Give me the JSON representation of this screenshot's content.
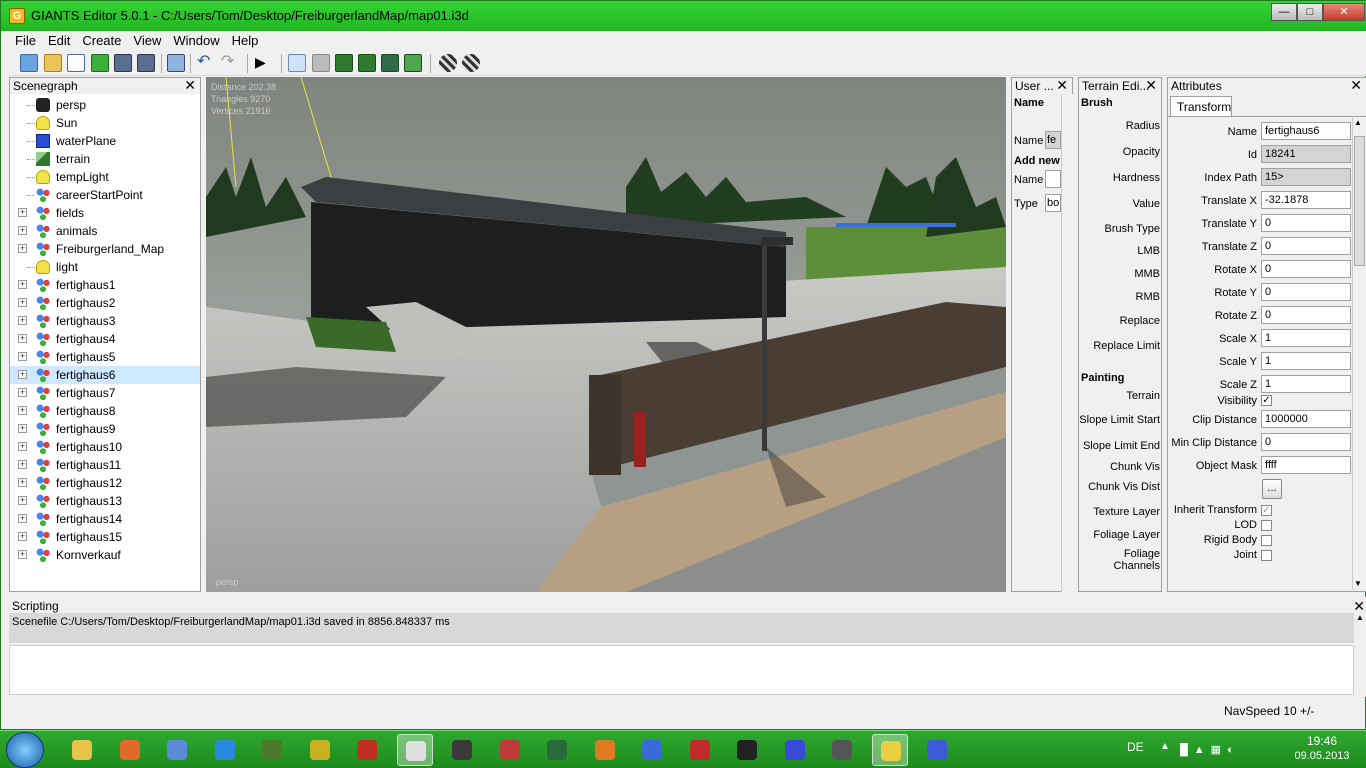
{
  "window": {
    "title": "GIANTS Editor 5.0.1 - C:/Users/Tom/Desktop/FreiburgerlandMap/map01.i3d",
    "app_icon": "G"
  },
  "menu": [
    "File",
    "Edit",
    "Create",
    "View",
    "Window",
    "Help"
  ],
  "scenegraph": {
    "title": "Scenegraph",
    "nodes": [
      {
        "label": "persp",
        "icon": "camera-icon",
        "expandable": false
      },
      {
        "label": "Sun",
        "icon": "light-bulb-icon",
        "expandable": false
      },
      {
        "label": "waterPlane",
        "icon": "cube-icon",
        "expandable": false
      },
      {
        "label": "terrain",
        "icon": "terrain-icon",
        "expandable": false
      },
      {
        "label": "tempLight",
        "icon": "light-bulb-icon",
        "expandable": false
      },
      {
        "label": "careerStartPoint",
        "icon": "transform-group-icon",
        "expandable": false
      },
      {
        "label": "fields",
        "icon": "transform-group-icon",
        "expandable": true
      },
      {
        "label": "animals",
        "icon": "transform-group-icon",
        "expandable": true
      },
      {
        "label": "Freiburgerland_Map",
        "icon": "transform-group-icon",
        "expandable": true
      },
      {
        "label": "light",
        "icon": "light-bulb-icon",
        "expandable": false
      },
      {
        "label": "fertighaus1",
        "icon": "transform-group-icon",
        "expandable": true
      },
      {
        "label": "fertighaus2",
        "icon": "transform-group-icon",
        "expandable": true
      },
      {
        "label": "fertighaus3",
        "icon": "transform-group-icon",
        "expandable": true
      },
      {
        "label": "fertighaus4",
        "icon": "transform-group-icon",
        "expandable": true
      },
      {
        "label": "fertighaus5",
        "icon": "transform-group-icon",
        "expandable": true
      },
      {
        "label": "fertighaus6",
        "icon": "transform-group-icon",
        "expandable": true,
        "selected": true
      },
      {
        "label": "fertighaus7",
        "icon": "transform-group-icon",
        "expandable": true
      },
      {
        "label": "fertighaus8",
        "icon": "transform-group-icon",
        "expandable": true
      },
      {
        "label": "fertighaus9",
        "icon": "transform-group-icon",
        "expandable": true
      },
      {
        "label": "fertighaus10",
        "icon": "transform-group-icon",
        "expandable": true
      },
      {
        "label": "fertighaus11",
        "icon": "transform-group-icon",
        "expandable": true
      },
      {
        "label": "fertighaus12",
        "icon": "transform-group-icon",
        "expandable": true
      },
      {
        "label": "fertighaus13",
        "icon": "transform-group-icon",
        "expandable": true
      },
      {
        "label": "fertighaus14",
        "icon": "transform-group-icon",
        "expandable": true
      },
      {
        "label": "fertighaus15",
        "icon": "transform-group-icon",
        "expandable": true
      },
      {
        "label": "Kornverkauf",
        "icon": "transform-group-icon",
        "expandable": true
      }
    ]
  },
  "viewport": {
    "info": [
      "Distance 202.38",
      "Triangles 9270",
      "Vertices 21916"
    ],
    "camera_label": "persp"
  },
  "user_panel": {
    "title": "User ...",
    "name_header": "Name",
    "name_label": "Name",
    "name_value": "fe",
    "add_new": "Add new",
    "name2_label": "Name",
    "type_label": "Type",
    "type_value": "bo"
  },
  "terrain_panel": {
    "title": "Terrain Edi...",
    "brush_header": "Brush",
    "brush_labels": [
      "Radius",
      "Opacity",
      "Hardness",
      "Value",
      "Brush Type",
      "LMB",
      "MMB",
      "RMB",
      "Replace",
      "Replace Limit"
    ],
    "painting_header": "Painting",
    "painting_labels": [
      "Terrain",
      "Slope Limit Start",
      "Slope Limit End",
      "Chunk Vis",
      "Chunk Vis Dist",
      "Texture Layer",
      "Foliage Layer",
      "Foliage Channels"
    ]
  },
  "attributes": {
    "title": "Attributes",
    "tab": "Transform",
    "fields": [
      {
        "label": "Name",
        "value": "fertighaus6",
        "readonly": false
      },
      {
        "label": "Id",
        "value": "18241",
        "readonly": true
      },
      {
        "label": "Index Path",
        "value": "15>",
        "readonly": true
      },
      {
        "label": "Translate X",
        "value": "-32.1878",
        "readonly": false
      },
      {
        "label": "Translate Y",
        "value": "0",
        "readonly": false
      },
      {
        "label": "Translate Z",
        "value": "0",
        "readonly": false
      },
      {
        "label": "Rotate X",
        "value": "0",
        "readonly": false
      },
      {
        "label": "Rotate Y",
        "value": "0",
        "readonly": false
      },
      {
        "label": "Rotate Z",
        "value": "0",
        "readonly": false
      },
      {
        "label": "Scale X",
        "value": "1",
        "readonly": false
      },
      {
        "label": "Scale Y",
        "value": "1",
        "readonly": false
      },
      {
        "label": "Scale Z",
        "value": "1",
        "readonly": false
      }
    ],
    "visibility_label": "Visibility",
    "clip_distance_label": "Clip Distance",
    "clip_distance_value": "1000000",
    "min_clip_label": "Min Clip Distance",
    "min_clip_value": "0",
    "object_mask_label": "Object Mask",
    "object_mask_value": "ffff",
    "ellipsis_label": "...",
    "checks": [
      {
        "label": "Inherit Transform",
        "checked": true
      },
      {
        "label": "LOD",
        "checked": false
      },
      {
        "label": "Rigid Body",
        "checked": false
      },
      {
        "label": "Joint",
        "checked": false
      }
    ]
  },
  "scripting": {
    "title": "Scripting",
    "log": "Scenefile C:/Users/Tom/Desktop/FreiburgerlandMap/map01.i3d saved in 8856.848337 ms"
  },
  "statusbar": {
    "navspeed": "NavSpeed 10 +/-"
  },
  "taskbar": {
    "language": "DE",
    "time": "19:46",
    "date": "09.05.2013",
    "apps": [
      "windows-explorer-icon",
      "media-player-icon",
      "paint-icon",
      "internet-explorer-icon",
      "minecraft-icon",
      "99-icon",
      "em2012-icon",
      "chrome-icon",
      "tractor-icon",
      "farming-simulator-icon",
      "steam-like-icon",
      "blender-icon",
      "bird-icon",
      "quad-icon",
      "2-icon",
      "messenger-icon",
      "inkscape-icon",
      "giants-icon",
      "paint-net-icon"
    ]
  },
  "colors": {
    "accent": "#22b522",
    "selection": "#cde8ff",
    "taskbar": "#1d8a1d"
  }
}
